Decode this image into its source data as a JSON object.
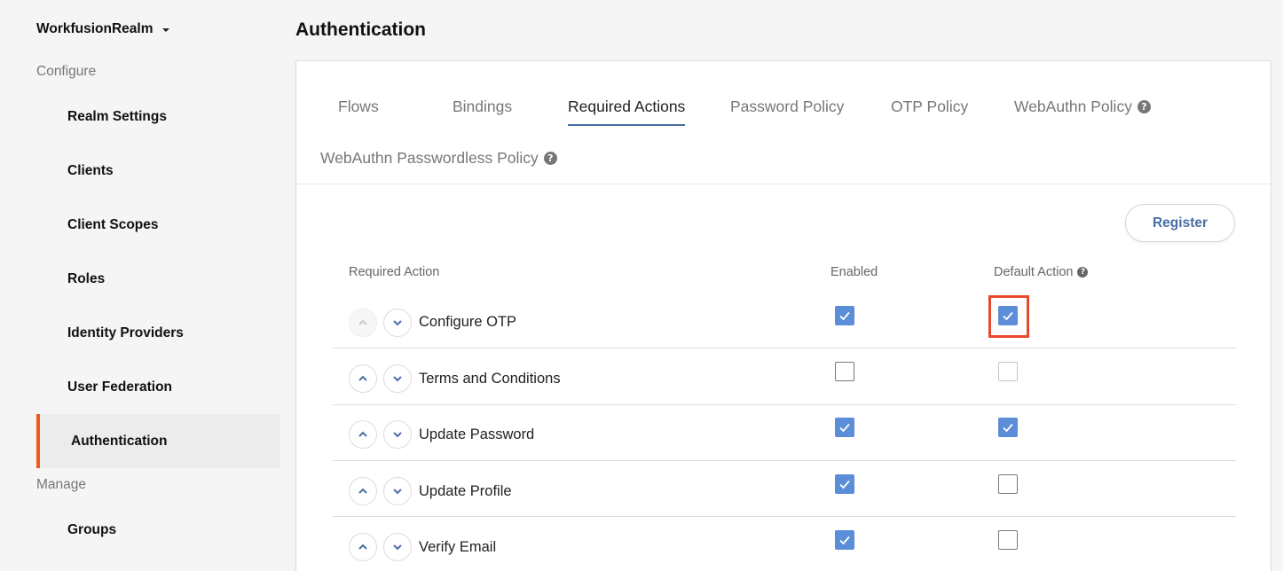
{
  "sidebar": {
    "realm": "WorkfusionRealm",
    "sections": {
      "configure": "Configure",
      "manage": "Manage"
    },
    "items": [
      {
        "label": "Realm Settings",
        "active": false
      },
      {
        "label": "Clients",
        "active": false
      },
      {
        "label": "Client Scopes",
        "active": false
      },
      {
        "label": "Roles",
        "active": false
      },
      {
        "label": "Identity Providers",
        "active": false
      },
      {
        "label": "User Federation",
        "active": false
      },
      {
        "label": "Authentication",
        "active": true
      },
      {
        "label": "Groups",
        "active": false
      }
    ],
    "accent_color": "#ee5a1e"
  },
  "main": {
    "title": "Authentication",
    "tabs": [
      {
        "label": "Flows"
      },
      {
        "label": "Bindings"
      },
      {
        "label": "Required Actions",
        "active": true
      },
      {
        "label": "Password Policy"
      },
      {
        "label": "OTP Policy"
      },
      {
        "label": "WebAuthn Policy",
        "help": true
      },
      {
        "label": "WebAuthn Passwordless Policy",
        "help": true
      }
    ],
    "register_label": "Register",
    "table": {
      "headers": {
        "action": "Required Action",
        "enabled": "Enabled",
        "default": "Default Action"
      },
      "rows": [
        {
          "name": "Configure OTP",
          "enabled": true,
          "default_action": true,
          "up_disabled": true
        },
        {
          "name": "Terms and Conditions",
          "enabled": false,
          "default_action": false,
          "default_disabled": true
        },
        {
          "name": "Update Password",
          "enabled": true,
          "default_action": true
        },
        {
          "name": "Update Profile",
          "enabled": true,
          "default_action": false
        },
        {
          "name": "Verify Email",
          "enabled": true,
          "default_action": false
        }
      ]
    },
    "checkbox_color": "#5b8dd9",
    "highlight_color": "#e8492a"
  }
}
